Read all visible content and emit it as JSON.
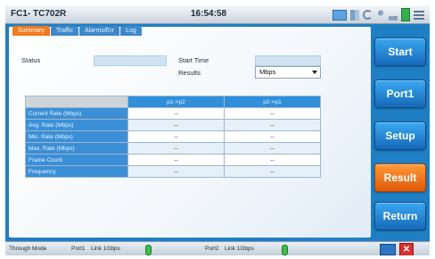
{
  "window": {
    "title": "FC1- TC702R",
    "clock": "16:54:58"
  },
  "tray_icons": [
    "monitor-icon",
    "network-icon",
    "refresh-icon",
    "person-icon",
    "signal-icon",
    "battery-icon",
    "menu-icon"
  ],
  "tabs": [
    {
      "label": "Summary",
      "active": true
    },
    {
      "label": "Traffic",
      "active": false
    },
    {
      "label": "Alarms/Err",
      "active": false
    },
    {
      "label": "Log",
      "active": false
    }
  ],
  "form": {
    "status_label": "Status",
    "status_value": "",
    "start_time_label": "Start Time",
    "start_time_value": "",
    "results_label": "Results",
    "results_value": "Mbps"
  },
  "table": {
    "headers": [
      "",
      "p1->p2",
      "p2->p1"
    ],
    "rows": [
      {
        "label": "Current Rate (Mbps)",
        "p1_p2": "--",
        "p2_p1": "--"
      },
      {
        "label": "Avg. Rate (Mbps)",
        "p1_p2": "--",
        "p2_p1": "--"
      },
      {
        "label": "Min. Rate (Mbps)",
        "p1_p2": "--",
        "p2_p1": "--"
      },
      {
        "label": "Max. Rate (Mbps)",
        "p1_p2": "--",
        "p2_p1": "--"
      },
      {
        "label": "Frame Count",
        "p1_p2": "--",
        "p2_p1": "--"
      },
      {
        "label": "Frequency",
        "p1_p2": "--",
        "p2_p1": "--"
      }
    ]
  },
  "side_buttons": {
    "start": "Start",
    "port1": "Port1",
    "setup": "Setup",
    "result": "Result",
    "return": "Return"
  },
  "statusbar": {
    "mode": "Through Mode",
    "port1_label": "Port1",
    "port1_link": "Link 1Gbps",
    "port2_label": "Port2",
    "port2_link": "Link 1Gbps"
  },
  "colors": {
    "frame_blue": "#1f7fc4",
    "tab_active": "#f07a1e",
    "button_blue": "#1669b8",
    "button_orange": "#dd5a0a",
    "link_led": "#3cc04a"
  }
}
